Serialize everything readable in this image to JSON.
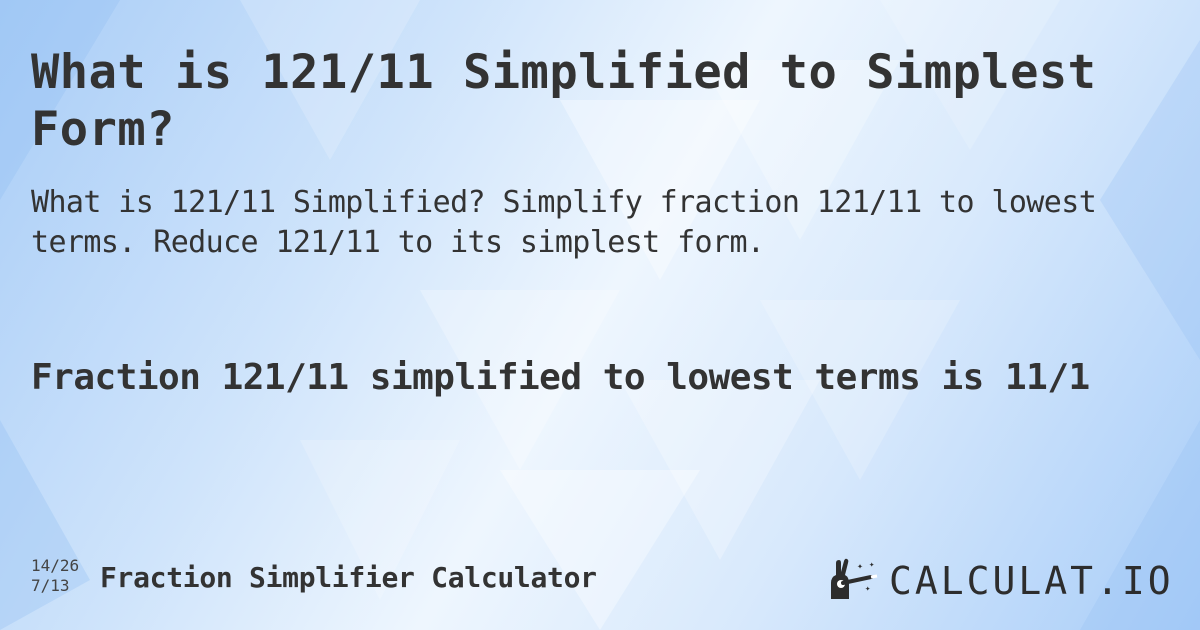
{
  "title": "What is 121/11 Simplified to Simplest Form?",
  "subtitle": "What is 121/11 Simplified? Simplify fraction 121/11 to lowest terms. Reduce 121/11 to its simplest form.",
  "result": "Fraction 121/11 simplified to lowest terms is 11/1",
  "footer": {
    "fraction_top": "14/26",
    "fraction_bottom": "7/13",
    "calculator_name": "Fraction Simplifier Calculator"
  },
  "logo": {
    "text": "CALCULAT.IO",
    "icon": "magic-wand-hand-icon"
  },
  "colors": {
    "text": "#333333",
    "background_light": "#eef6fe",
    "background_blue": "#a9cdf7"
  }
}
